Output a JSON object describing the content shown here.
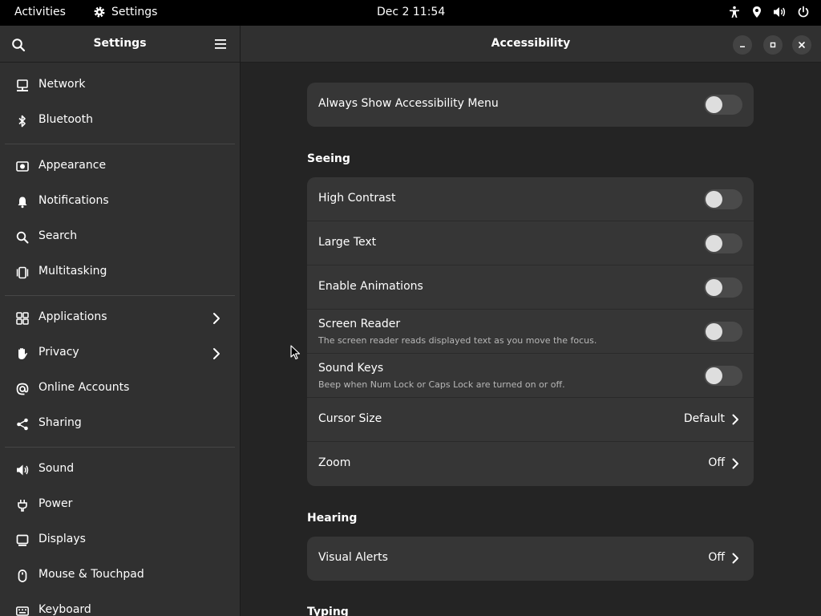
{
  "topbar": {
    "activities": "Activities",
    "app_name": "Settings",
    "clock": "Dec 2  11:54"
  },
  "sidebar": {
    "title": "Settings",
    "groups": [
      [
        {
          "label": "Network",
          "icon": "network-icon"
        },
        {
          "label": "Bluetooth",
          "icon": "bluetooth-icon"
        }
      ],
      [
        {
          "label": "Appearance",
          "icon": "appearance-icon"
        },
        {
          "label": "Notifications",
          "icon": "bell-icon"
        },
        {
          "label": "Search",
          "icon": "search-icon"
        },
        {
          "label": "Multitasking",
          "icon": "multitasking-icon"
        }
      ],
      [
        {
          "label": "Applications",
          "icon": "applications-icon",
          "chevron": true
        },
        {
          "label": "Privacy",
          "icon": "privacy-icon",
          "chevron": true
        },
        {
          "label": "Online Accounts",
          "icon": "at-icon"
        },
        {
          "label": "Sharing",
          "icon": "share-icon"
        }
      ],
      [
        {
          "label": "Sound",
          "icon": "speaker-icon"
        },
        {
          "label": "Power",
          "icon": "power-plug-icon"
        },
        {
          "label": "Displays",
          "icon": "display-icon"
        },
        {
          "label": "Mouse & Touchpad",
          "icon": "mouse-icon"
        },
        {
          "label": "Keyboard",
          "icon": "keyboard-icon"
        }
      ]
    ]
  },
  "main": {
    "title": "Accessibility",
    "always_show_menu": {
      "label": "Always Show Accessibility Menu",
      "on": false
    },
    "seeing": {
      "title": "Seeing",
      "rows": {
        "high_contrast": {
          "label": "High Contrast",
          "on": false
        },
        "large_text": {
          "label": "Large Text",
          "on": false
        },
        "enable_animations": {
          "label": "Enable Animations",
          "on": false
        },
        "screen_reader": {
          "label": "Screen Reader",
          "subtitle": "The screen reader reads displayed text as you move the focus.",
          "on": false
        },
        "sound_keys": {
          "label": "Sound Keys",
          "subtitle": "Beep when Num Lock or Caps Lock are turned on or off.",
          "on": false
        },
        "cursor_size": {
          "label": "Cursor Size",
          "value": "Default"
        },
        "zoom": {
          "label": "Zoom",
          "value": "Off"
        }
      }
    },
    "hearing": {
      "title": "Hearing",
      "visual_alerts": {
        "label": "Visual Alerts",
        "value": "Off"
      }
    },
    "typing": {
      "title": "Typing"
    }
  },
  "colors": {
    "window_bg": "#242424",
    "sidebar_bg": "#303030",
    "card_bg": "#363636",
    "toggle_off": "#4a4a4a"
  }
}
